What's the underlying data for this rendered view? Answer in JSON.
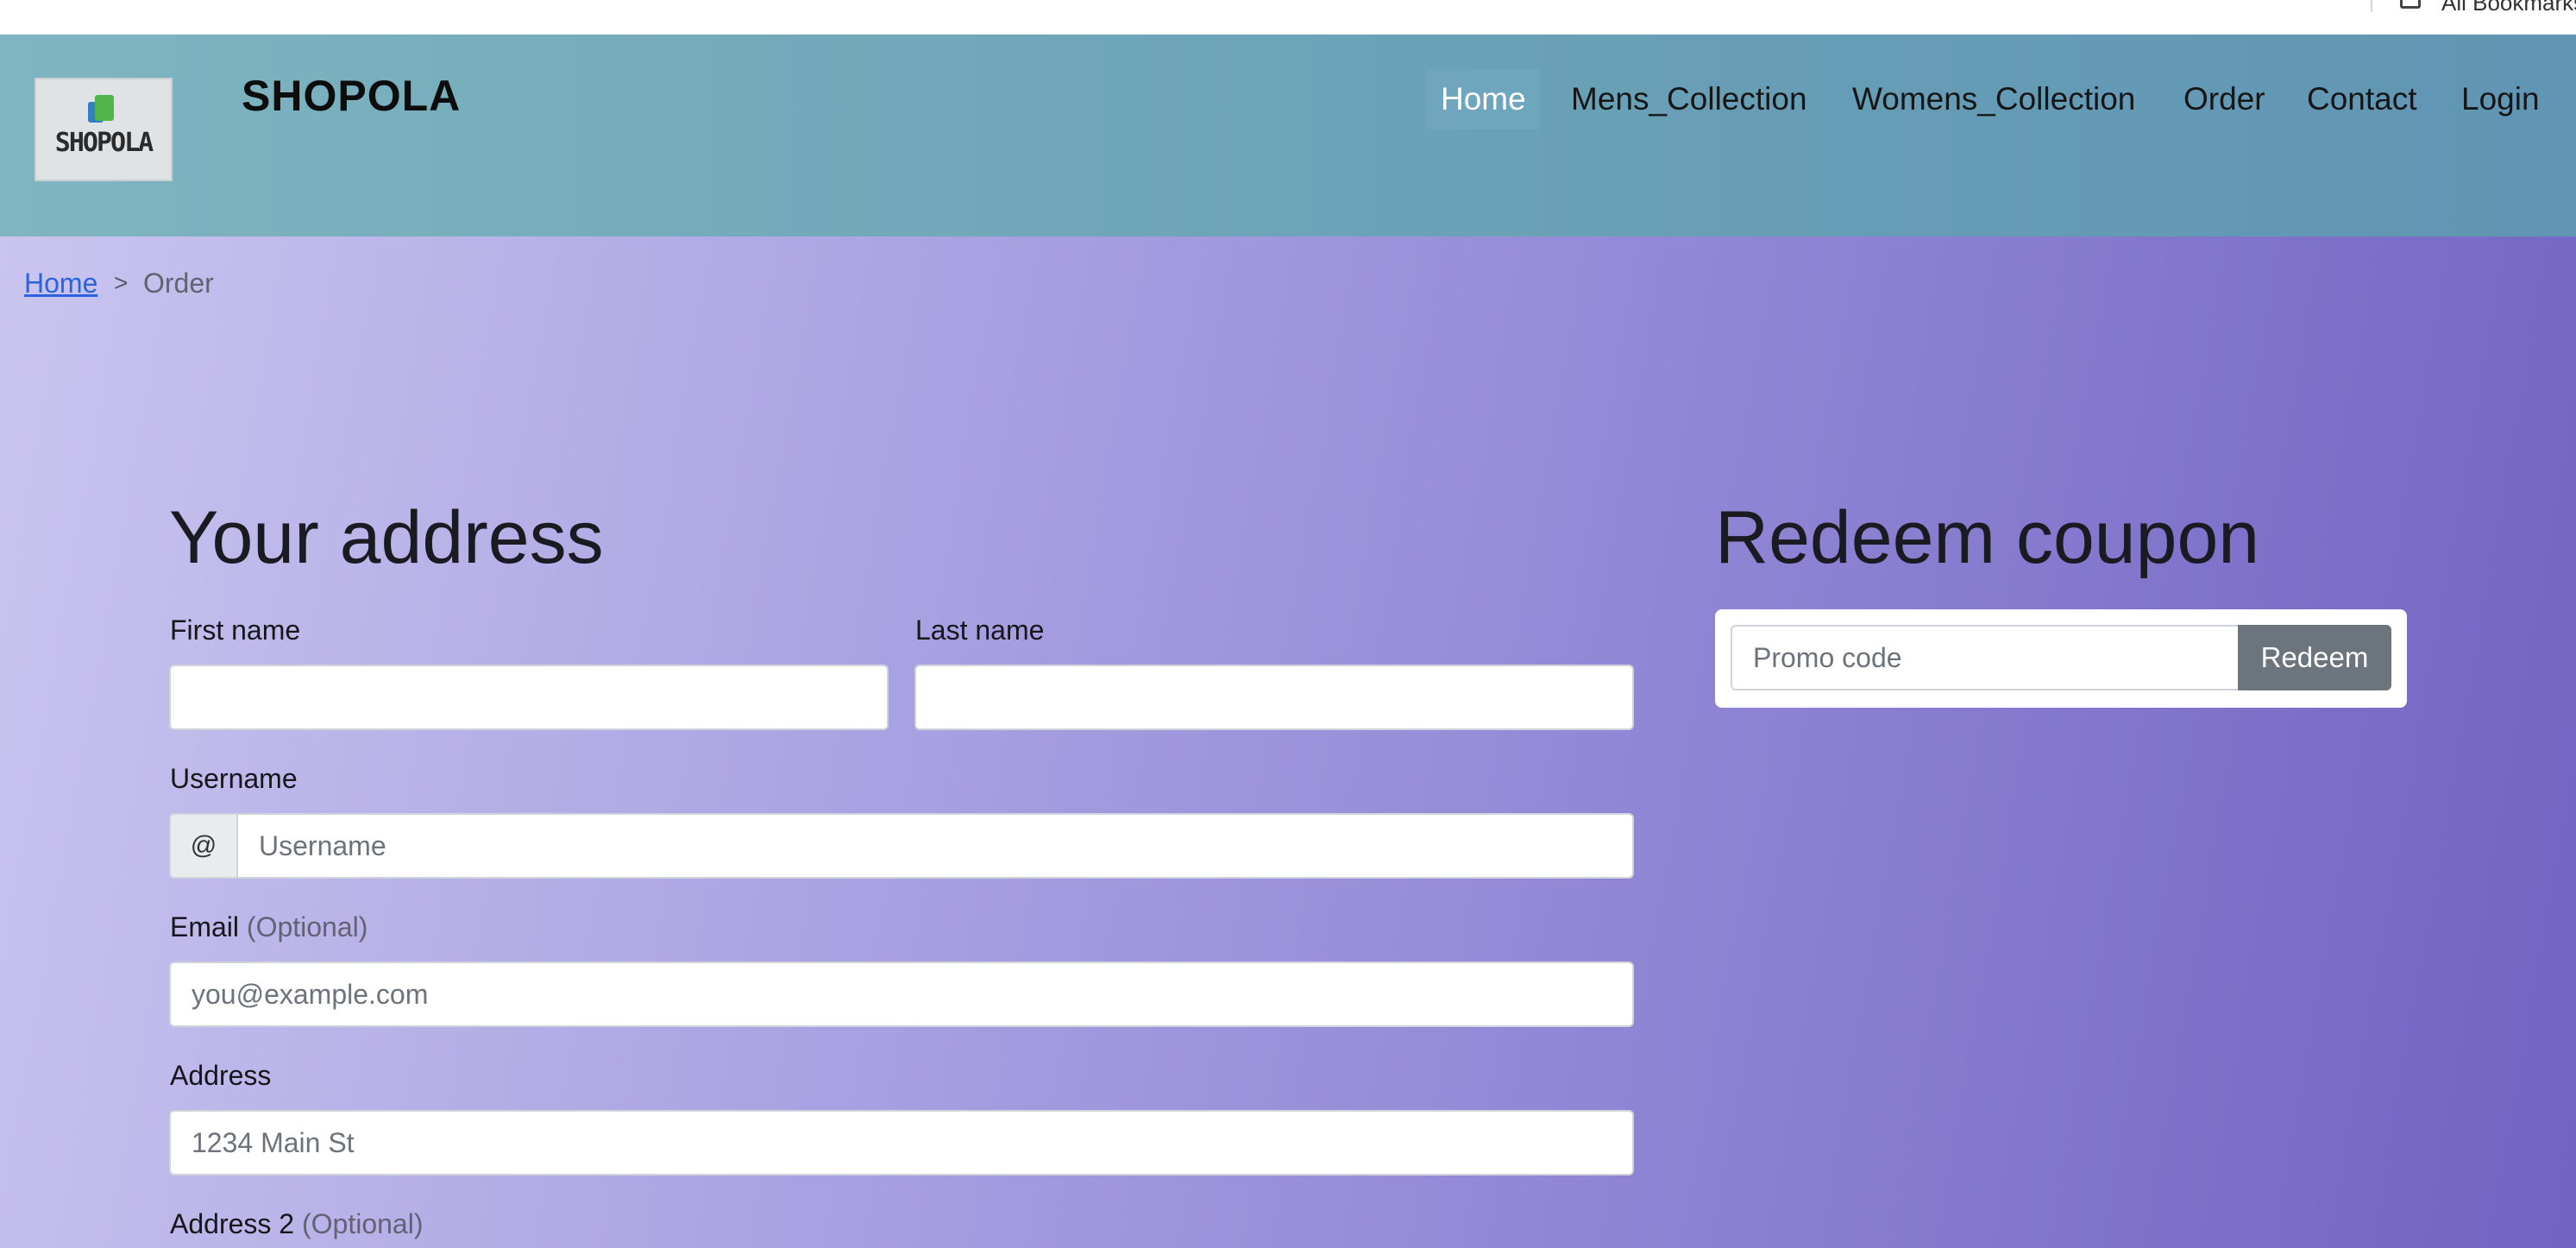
{
  "browser": {
    "bookmarks_label": "All Bookmarks"
  },
  "navbar": {
    "brand": "SHOPOLA",
    "logo_text": "SHOPOLA",
    "items": [
      {
        "label": "Home",
        "active": true
      },
      {
        "label": "Mens_Collection"
      },
      {
        "label": "Womens_Collection"
      },
      {
        "label": "Order"
      },
      {
        "label": "Contact"
      },
      {
        "label": "Login"
      }
    ]
  },
  "breadcrumb": {
    "home": "Home",
    "separator": ">",
    "current": "Order"
  },
  "address_form": {
    "title": "Your address",
    "first_name_label": "First name",
    "last_name_label": "Last name",
    "username_label": "Username",
    "username_prefix": "@",
    "username_placeholder": "Username",
    "email_label": "Email",
    "email_optional": "(Optional)",
    "email_placeholder": "you@example.com",
    "address_label": "Address",
    "address_placeholder": "1234 Main St",
    "address2_label": "Address 2",
    "address2_optional": "(Optional)"
  },
  "coupon": {
    "title": "Redeem coupon",
    "promo_placeholder": "Promo code",
    "redeem_label": "Redeem"
  },
  "colors": {
    "navbar_gradient": [
      "#7fb5c0",
      "#6095b3"
    ],
    "page_gradient": [
      "#c9c5ef",
      "#7262c2"
    ],
    "link": "#2a63e0",
    "button_secondary": "#6c757d"
  }
}
